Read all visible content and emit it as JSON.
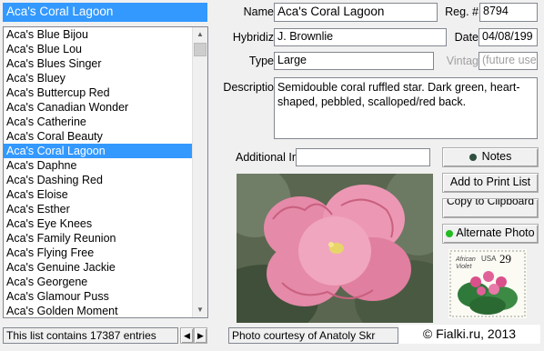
{
  "search": {
    "value": "Aca's Coral Lagoon"
  },
  "list": {
    "items": [
      "Aca's Blue Bijou",
      "Aca's Blue Lou",
      "Aca's Blues Singer",
      "Aca's Bluey",
      "Aca's Buttercup Red",
      "Aca's Canadian Wonder",
      "Aca's Catherine",
      "Aca's Coral Beauty",
      "Aca's Coral Lagoon",
      "Aca's Daphne",
      "Aca's Dashing Red",
      "Aca's Eloise",
      "Aca's Esther",
      "Aca's Eye Knees",
      "Aca's Family Reunion",
      "Aca's Flying Free",
      "Aca's Genuine Jackie",
      "Aca's Georgene",
      "Aca's Glamour Puss",
      "Aca's Golden Moment"
    ],
    "selected": "Aca's Coral Lagoon",
    "status": "This list contains 17387 entries"
  },
  "form": {
    "name_label": "Name",
    "name_value": "Aca's Coral Lagoon",
    "reg_label": "Reg. #",
    "reg_value": "8794",
    "hybridizer_label": "Hybridiz",
    "hybridizer_value": "J. Brownlie",
    "date_label": "Date",
    "date_value": "04/08/199",
    "type_label": "Type",
    "type_value": "Large",
    "vintage_label": "Vintag",
    "vintage_value": "(future use",
    "description_label": "Descriptio",
    "description_value": "Semidouble coral ruffled star. Dark green, heart-shaped, pebbled, scalloped/red back.",
    "additional_label": "Additional Ir",
    "additional_value": ""
  },
  "buttons": {
    "notes": "Notes",
    "add_print": "Add to Print List",
    "copy_clipboard": "Copy to Clipboard",
    "alternate_photo": "Alternate Photo"
  },
  "stamp": {
    "text": "African Violet",
    "usa": "USA",
    "value": "29"
  },
  "photo_credit": "Photo courtesy of Anatoly Skr",
  "watermark": "© Fialki.ru, 2013",
  "colors": {
    "selection": "#3399ff",
    "notes_dot": "#2f4f3f",
    "alt_dot": "#22bb22"
  }
}
